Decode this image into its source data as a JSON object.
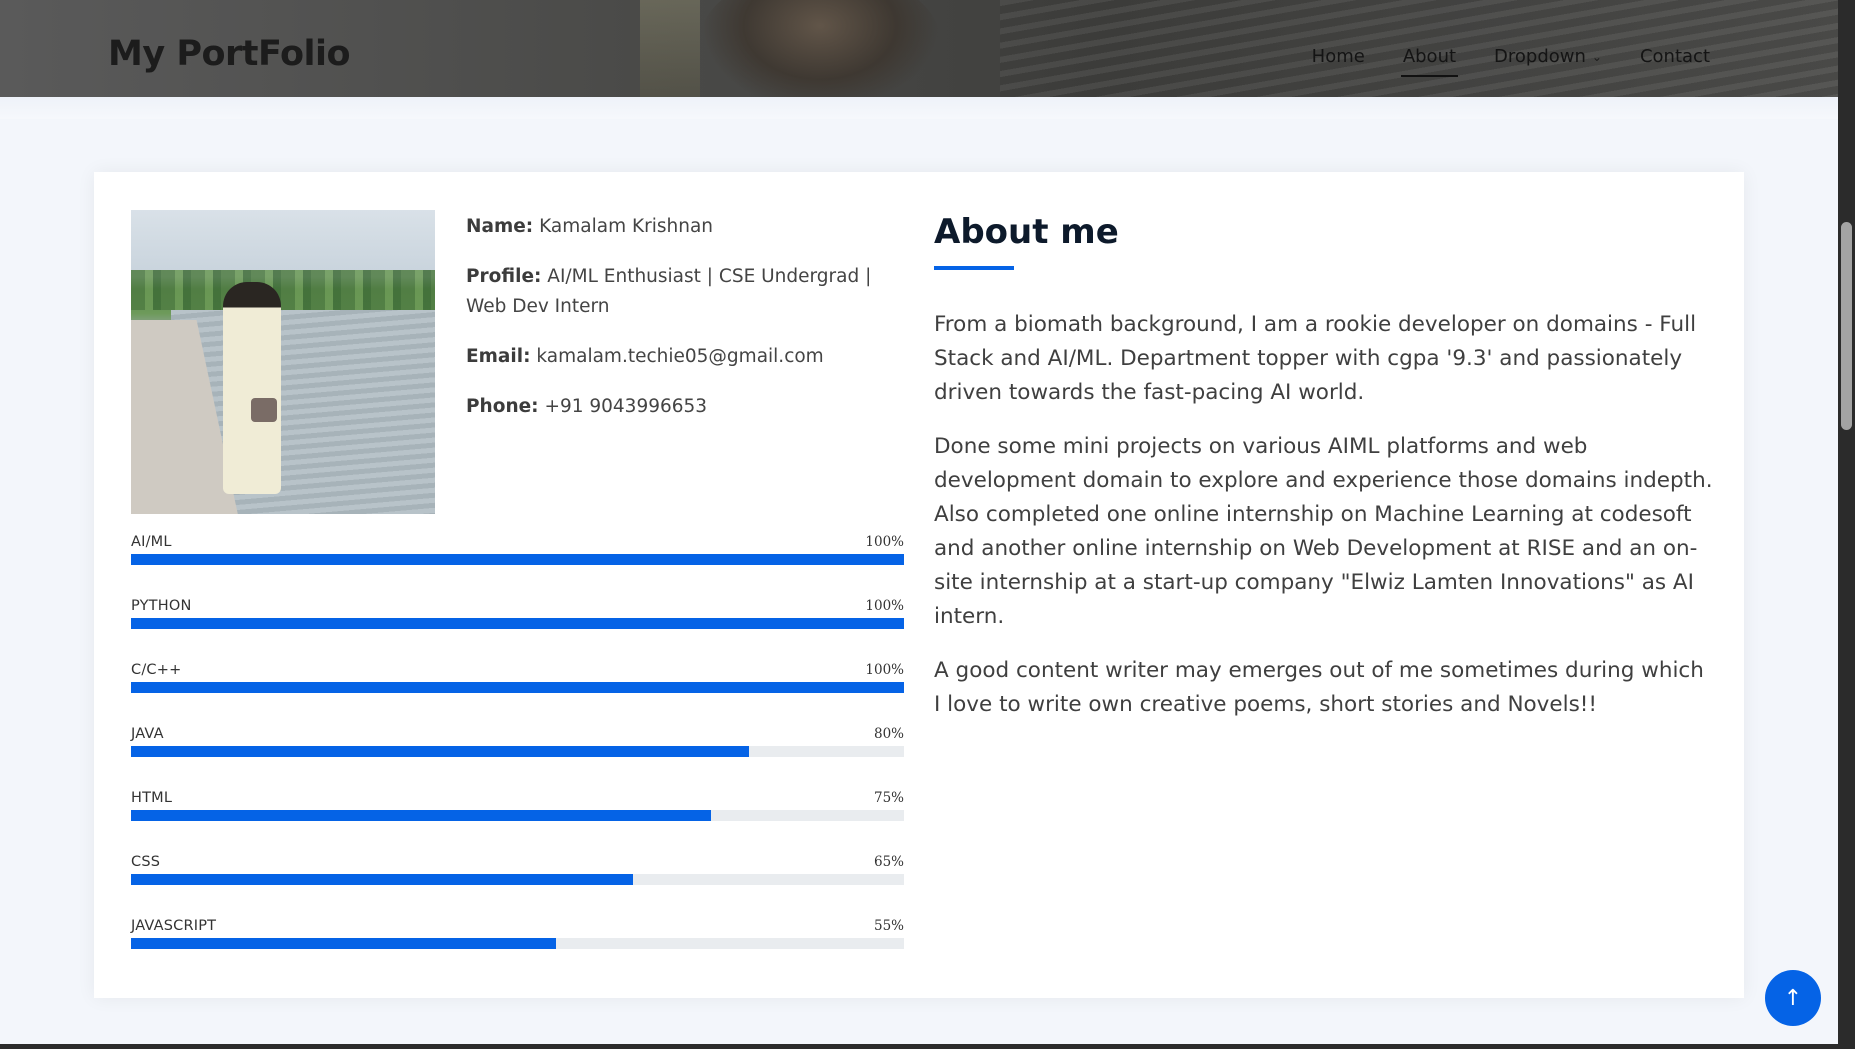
{
  "header": {
    "logo": "My PortFolio",
    "nav": [
      {
        "label": "Home"
      },
      {
        "label": "About",
        "active": true
      },
      {
        "label": "Dropdown",
        "has_dropdown": true
      },
      {
        "label": "Contact"
      }
    ]
  },
  "profile": {
    "photo_icon": "profile-photo",
    "fields": [
      {
        "key": "Name:",
        "value": "Kamalam Krishnan"
      },
      {
        "key": "Profile:",
        "value": "AI/ML Enthusiast | CSE Undergrad | Web Dev Intern"
      },
      {
        "key": "Email:",
        "value": "kamalam.techie05@gmail.com"
      },
      {
        "key": "Phone:",
        "value": "+91 9043996653"
      }
    ]
  },
  "skills": [
    {
      "name": "AI/ML",
      "percent_label": "100%",
      "percent": 100
    },
    {
      "name": "PYTHON",
      "percent_label": "100%",
      "percent": 100
    },
    {
      "name": "C/C++",
      "percent_label": "100%",
      "percent": 100
    },
    {
      "name": "JAVA",
      "percent_label": "80%",
      "percent": 80
    },
    {
      "name": "HTML",
      "percent_label": "75%",
      "percent": 75
    },
    {
      "name": "CSS",
      "percent_label": "65%",
      "percent": 65
    },
    {
      "name": "JAVASCRIPT",
      "percent_label": "55%",
      "percent": 55
    }
  ],
  "about": {
    "title": "About me",
    "paragraphs": [
      "From a biomath background, I am a rookie developer on domains - Full Stack and AI/ML. Department topper with cgpa '9.3' and passionately driven towards the fast-pacing AI world.",
      "Done some mini projects on various AIML platforms and web development domain to explore and experience those domains indepth. Also completed one online internship on Machine Learning at codesoft and another online internship on Web Development at RISE and an on-site internship at a start-up company \"Elwiz Lamten Innovations\" as AI intern.",
      "A good content writer may emerges out of me sometimes during which I love to write own creative poems, short stories and Novels!!"
    ]
  },
  "back_to_top": {
    "icon": "arrow-up-icon",
    "glyph": "↑"
  },
  "colors": {
    "accent": "#0563e6",
    "bar_track": "#e9ecef"
  }
}
